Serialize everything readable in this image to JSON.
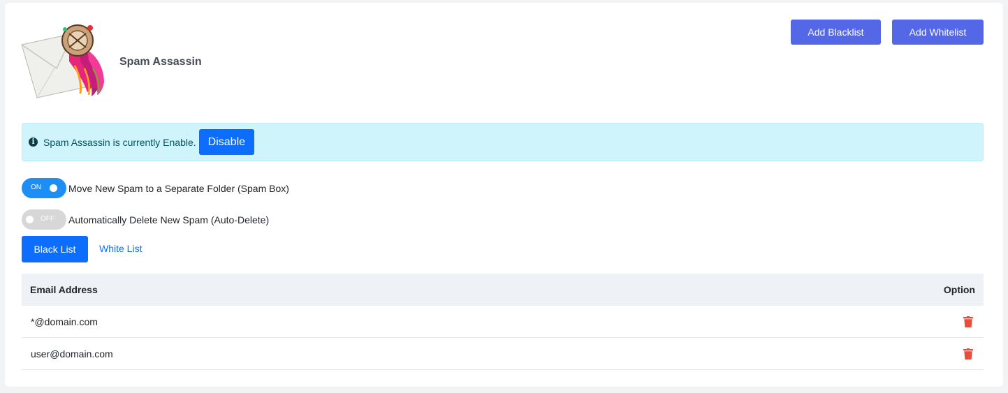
{
  "header": {
    "title": "Spam Assassin",
    "add_blacklist_label": "Add Blacklist",
    "add_whitelist_label": "Add Whitelist"
  },
  "status": {
    "message": "Spam Assassin is currently Enable.",
    "action_label": "Disable"
  },
  "settings": [
    {
      "state_label": "ON",
      "enabled": true,
      "label": "Move New Spam to a Separate Folder (Spam Box)"
    },
    {
      "state_label": "OFF",
      "enabled": false,
      "label": "Automatically Delete New Spam (Auto-Delete)"
    }
  ],
  "tabs": [
    {
      "label": "Black List",
      "active": true
    },
    {
      "label": "White List",
      "active": false
    }
  ],
  "table": {
    "columns": [
      "Email Address",
      "Option"
    ],
    "rows": [
      {
        "email": "*@domain.com",
        "option_icon": "trash-icon"
      },
      {
        "email": "user@domain.com",
        "option_icon": "trash-icon"
      }
    ]
  },
  "colors": {
    "primary": "#0d6efd",
    "accent_button": "#5468e7",
    "toggle_on": "#1c8ef5",
    "toggle_off": "#d7d7d7",
    "alert_bg": "#cff4fc",
    "delete": "#e74c3c"
  }
}
